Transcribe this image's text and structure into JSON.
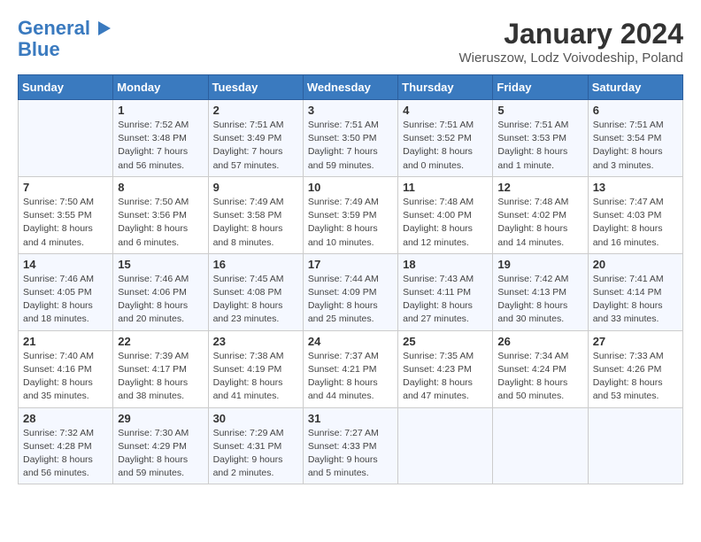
{
  "header": {
    "logo_line1": "General",
    "logo_line2": "Blue",
    "title": "January 2024",
    "subtitle": "Wieruszow, Lodz Voivodeship, Poland"
  },
  "days_of_week": [
    "Sunday",
    "Monday",
    "Tuesday",
    "Wednesday",
    "Thursday",
    "Friday",
    "Saturday"
  ],
  "weeks": [
    [
      {
        "day": "",
        "info": ""
      },
      {
        "day": "1",
        "info": "Sunrise: 7:52 AM\nSunset: 3:48 PM\nDaylight: 7 hours\nand 56 minutes."
      },
      {
        "day": "2",
        "info": "Sunrise: 7:51 AM\nSunset: 3:49 PM\nDaylight: 7 hours\nand 57 minutes."
      },
      {
        "day": "3",
        "info": "Sunrise: 7:51 AM\nSunset: 3:50 PM\nDaylight: 7 hours\nand 59 minutes."
      },
      {
        "day": "4",
        "info": "Sunrise: 7:51 AM\nSunset: 3:52 PM\nDaylight: 8 hours\nand 0 minutes."
      },
      {
        "day": "5",
        "info": "Sunrise: 7:51 AM\nSunset: 3:53 PM\nDaylight: 8 hours\nand 1 minute."
      },
      {
        "day": "6",
        "info": "Sunrise: 7:51 AM\nSunset: 3:54 PM\nDaylight: 8 hours\nand 3 minutes."
      }
    ],
    [
      {
        "day": "7",
        "info": "Sunrise: 7:50 AM\nSunset: 3:55 PM\nDaylight: 8 hours\nand 4 minutes."
      },
      {
        "day": "8",
        "info": "Sunrise: 7:50 AM\nSunset: 3:56 PM\nDaylight: 8 hours\nand 6 minutes."
      },
      {
        "day": "9",
        "info": "Sunrise: 7:49 AM\nSunset: 3:58 PM\nDaylight: 8 hours\nand 8 minutes."
      },
      {
        "day": "10",
        "info": "Sunrise: 7:49 AM\nSunset: 3:59 PM\nDaylight: 8 hours\nand 10 minutes."
      },
      {
        "day": "11",
        "info": "Sunrise: 7:48 AM\nSunset: 4:00 PM\nDaylight: 8 hours\nand 12 minutes."
      },
      {
        "day": "12",
        "info": "Sunrise: 7:48 AM\nSunset: 4:02 PM\nDaylight: 8 hours\nand 14 minutes."
      },
      {
        "day": "13",
        "info": "Sunrise: 7:47 AM\nSunset: 4:03 PM\nDaylight: 8 hours\nand 16 minutes."
      }
    ],
    [
      {
        "day": "14",
        "info": "Sunrise: 7:46 AM\nSunset: 4:05 PM\nDaylight: 8 hours\nand 18 minutes."
      },
      {
        "day": "15",
        "info": "Sunrise: 7:46 AM\nSunset: 4:06 PM\nDaylight: 8 hours\nand 20 minutes."
      },
      {
        "day": "16",
        "info": "Sunrise: 7:45 AM\nSunset: 4:08 PM\nDaylight: 8 hours\nand 23 minutes."
      },
      {
        "day": "17",
        "info": "Sunrise: 7:44 AM\nSunset: 4:09 PM\nDaylight: 8 hours\nand 25 minutes."
      },
      {
        "day": "18",
        "info": "Sunrise: 7:43 AM\nSunset: 4:11 PM\nDaylight: 8 hours\nand 27 minutes."
      },
      {
        "day": "19",
        "info": "Sunrise: 7:42 AM\nSunset: 4:13 PM\nDaylight: 8 hours\nand 30 minutes."
      },
      {
        "day": "20",
        "info": "Sunrise: 7:41 AM\nSunset: 4:14 PM\nDaylight: 8 hours\nand 33 minutes."
      }
    ],
    [
      {
        "day": "21",
        "info": "Sunrise: 7:40 AM\nSunset: 4:16 PM\nDaylight: 8 hours\nand 35 minutes."
      },
      {
        "day": "22",
        "info": "Sunrise: 7:39 AM\nSunset: 4:17 PM\nDaylight: 8 hours\nand 38 minutes."
      },
      {
        "day": "23",
        "info": "Sunrise: 7:38 AM\nSunset: 4:19 PM\nDaylight: 8 hours\nand 41 minutes."
      },
      {
        "day": "24",
        "info": "Sunrise: 7:37 AM\nSunset: 4:21 PM\nDaylight: 8 hours\nand 44 minutes."
      },
      {
        "day": "25",
        "info": "Sunrise: 7:35 AM\nSunset: 4:23 PM\nDaylight: 8 hours\nand 47 minutes."
      },
      {
        "day": "26",
        "info": "Sunrise: 7:34 AM\nSunset: 4:24 PM\nDaylight: 8 hours\nand 50 minutes."
      },
      {
        "day": "27",
        "info": "Sunrise: 7:33 AM\nSunset: 4:26 PM\nDaylight: 8 hours\nand 53 minutes."
      }
    ],
    [
      {
        "day": "28",
        "info": "Sunrise: 7:32 AM\nSunset: 4:28 PM\nDaylight: 8 hours\nand 56 minutes."
      },
      {
        "day": "29",
        "info": "Sunrise: 7:30 AM\nSunset: 4:29 PM\nDaylight: 8 hours\nand 59 minutes."
      },
      {
        "day": "30",
        "info": "Sunrise: 7:29 AM\nSunset: 4:31 PM\nDaylight: 9 hours\nand 2 minutes."
      },
      {
        "day": "31",
        "info": "Sunrise: 7:27 AM\nSunset: 4:33 PM\nDaylight: 9 hours\nand 5 minutes."
      },
      {
        "day": "",
        "info": ""
      },
      {
        "day": "",
        "info": ""
      },
      {
        "day": "",
        "info": ""
      }
    ]
  ]
}
